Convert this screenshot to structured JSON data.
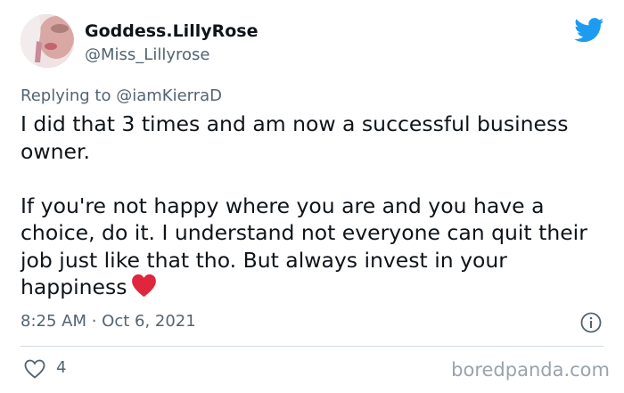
{
  "user": {
    "display_name": "Goddess.LillyRose",
    "handle": "@Miss_Lillyrose"
  },
  "reply": {
    "prefix": "Replying to ",
    "mention": "@iamKierraD"
  },
  "tweet": {
    "paragraph_1": "I did that 3 times and am now a successful business owner.",
    "paragraph_2": "If you're not happy where you are and you have a choice, do it. I understand not everyone can quit their job just like that tho. But always invest in your happiness",
    "emoji": "red-heart-emoji",
    "timestamp": "8:25 AM · Oct 6, 2021"
  },
  "actions": {
    "like_count": "4"
  },
  "icons": {
    "brand": "twitter-bird-icon",
    "info": "info-icon",
    "like": "heart-outline-icon"
  },
  "colors": {
    "brand_blue": "#1d9bf0",
    "heart_red": "#e0263c",
    "secondary_text": "#536471",
    "divider": "#cfd9de"
  },
  "watermark": "boredpanda.com"
}
